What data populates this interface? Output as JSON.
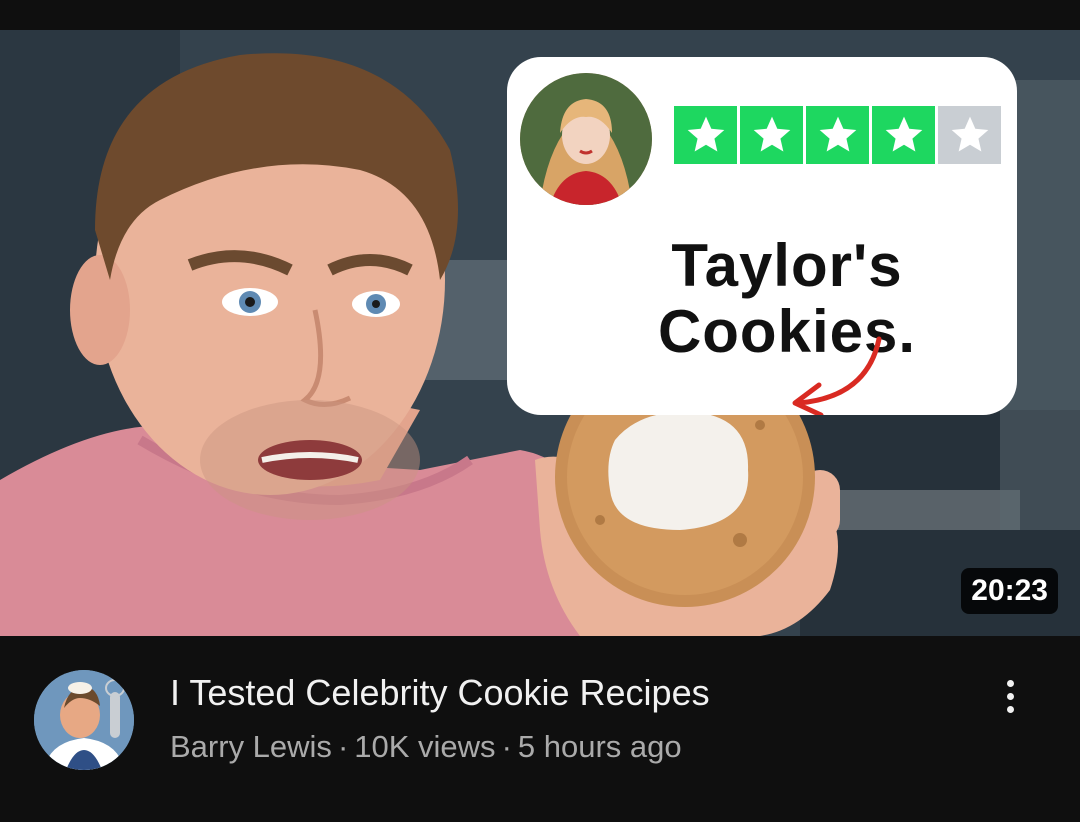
{
  "video": {
    "title": "I Tested Celebrity Cookie Recipes",
    "channel": "Barry Lewis",
    "views": "10K views",
    "age": "5 hours ago",
    "separator": "·",
    "duration": "20:23"
  },
  "thumbnail": {
    "card_title": "Taylor's\nCookies.",
    "rating": 4,
    "rating_max": 5
  },
  "colors": {
    "star_filled": "#1ed760",
    "star_empty": "#c9ced3",
    "shirt": "#d98b97",
    "card": "#ffffff",
    "arrow": "#d92a22",
    "background": "#0f0f0f"
  },
  "icons": {
    "menu": "more-vert-icon",
    "star": "star-icon"
  }
}
